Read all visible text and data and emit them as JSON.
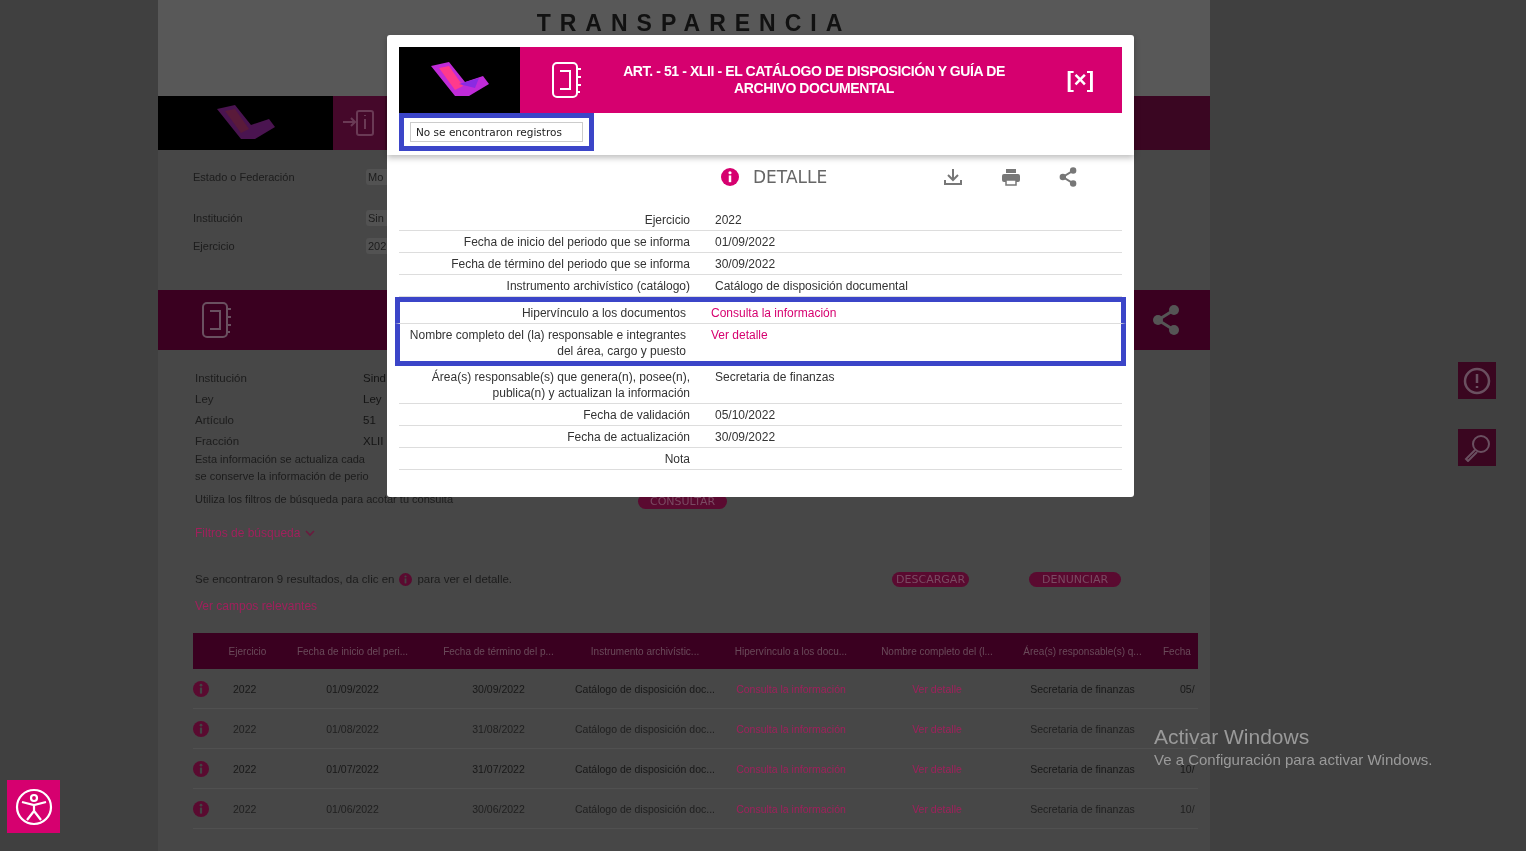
{
  "page": {
    "title": "TRANSPARENCIA"
  },
  "filters": [
    {
      "label": "Estado o Federación",
      "value": "Mo"
    },
    {
      "label": "Institución",
      "value": "Sin"
    },
    {
      "label": "Ejercicio",
      "value": "202"
    }
  ],
  "info": [
    {
      "label": "Institución",
      "value": "Sind"
    },
    {
      "label": "Ley",
      "value": "Ley"
    },
    {
      "label": "Artículo",
      "value": "51"
    },
    {
      "label": "Fracción",
      "value": "XLII"
    }
  ],
  "update_note": [
    "Esta información se actualiza cada",
    "se conserve la información de perio"
  ],
  "hint": "Utiliza los filtros de búsqueda para acotar tu consulta",
  "consult_button": "CONSULTAR",
  "filters_toggle": "Filtros de búsqueda",
  "results": {
    "before": "Se encontraron 9 resultados, da clic en",
    "after": "para ver el detalle."
  },
  "download_button": "DESCARGAR",
  "report_button": "DENUNCIAR",
  "relevant_link": "Ver campos relevantes",
  "table": {
    "columns": [
      {
        "label": "Ejercicio",
        "kind": "text"
      },
      {
        "label": "Fecha de inicio del peri...",
        "kind": "text"
      },
      {
        "label": "Fecha de término del p...",
        "kind": "text"
      },
      {
        "label": "Instrumento archivístic...",
        "kind": "text"
      },
      {
        "label": "Hipervínculo a los docu...",
        "kind": "link"
      },
      {
        "label": "Nombre completo del (l...",
        "kind": "link"
      },
      {
        "label": "Área(s) responsable(s) q...",
        "kind": "text"
      },
      {
        "label": "Fecha",
        "kind": "text"
      }
    ],
    "rows": [
      {
        "cells": [
          "2022",
          "01/09/2022",
          "30/09/2022",
          "Catálogo de disposición doc...",
          "Consulta la información",
          "Ver detalle",
          "Secretaria de finanzas",
          "05/"
        ]
      },
      {
        "cells": [
          "2022",
          "01/08/2022",
          "31/08/2022",
          "Catálogo de disposición doc...",
          "Consulta la información",
          "Ver detalle",
          "Secretaria de finanzas"
        ]
      },
      {
        "cells": [
          "2022",
          "01/07/2022",
          "31/07/2022",
          "Catálogo de disposición doc...",
          "Consulta la información",
          "Ver detalle",
          "Secretaria de finanzas",
          "10/"
        ]
      },
      {
        "cells": [
          "2022",
          "01/06/2022",
          "30/06/2022",
          "Catálogo de disposición doc...",
          "Consulta la información",
          "Ver detalle",
          "Secretaria de finanzas",
          "10/"
        ]
      }
    ]
  },
  "modal": {
    "title": "ART. - 51 - XLII - EL CATÁLOGO DE DISPOSICIÓN Y GUÍA DE ARCHIVO DOCUMENTAL",
    "close": "[×]",
    "notice": {
      "text": "No se encontraron registros",
      "highlighted": true
    },
    "heading": "DETALLE",
    "fields": [
      {
        "label": "Ejercicio",
        "value": "2022",
        "kind": "text",
        "highlighted": false
      },
      {
        "label": "Fecha de inicio del periodo que se informa",
        "value": "01/09/2022",
        "kind": "text",
        "highlighted": false
      },
      {
        "label": "Fecha de término del periodo que se informa",
        "value": "30/09/2022",
        "kind": "text",
        "highlighted": false
      },
      {
        "label": "Instrumento archivístico (catálogo)",
        "value": "Catálogo de disposición documental",
        "kind": "text",
        "highlighted": false
      },
      {
        "label": "Hipervínculo a los documentos",
        "value": "Consulta la información",
        "kind": "link",
        "highlighted": true
      },
      {
        "label": "Nombre completo del (la) responsable e integrantes del área, cargo y puesto",
        "value": "Ver detalle",
        "kind": "link",
        "highlighted": true
      },
      {
        "label": "Área(s) responsable(s) que genera(n), posee(n), publica(n) y actualizan la información",
        "value": "Secretaria de finanzas",
        "kind": "text",
        "highlighted": false
      },
      {
        "label": "Fecha de validación",
        "value": "05/10/2022",
        "kind": "text",
        "highlighted": false
      },
      {
        "label": "Fecha de actualización",
        "value": "30/09/2022",
        "kind": "text",
        "highlighted": false
      },
      {
        "label": "Nota",
        "kind": "text",
        "highlighted": false
      }
    ]
  },
  "os_notice": {
    "title": "Activar Windows",
    "text": "Ve a Configuración para activar Windows."
  }
}
